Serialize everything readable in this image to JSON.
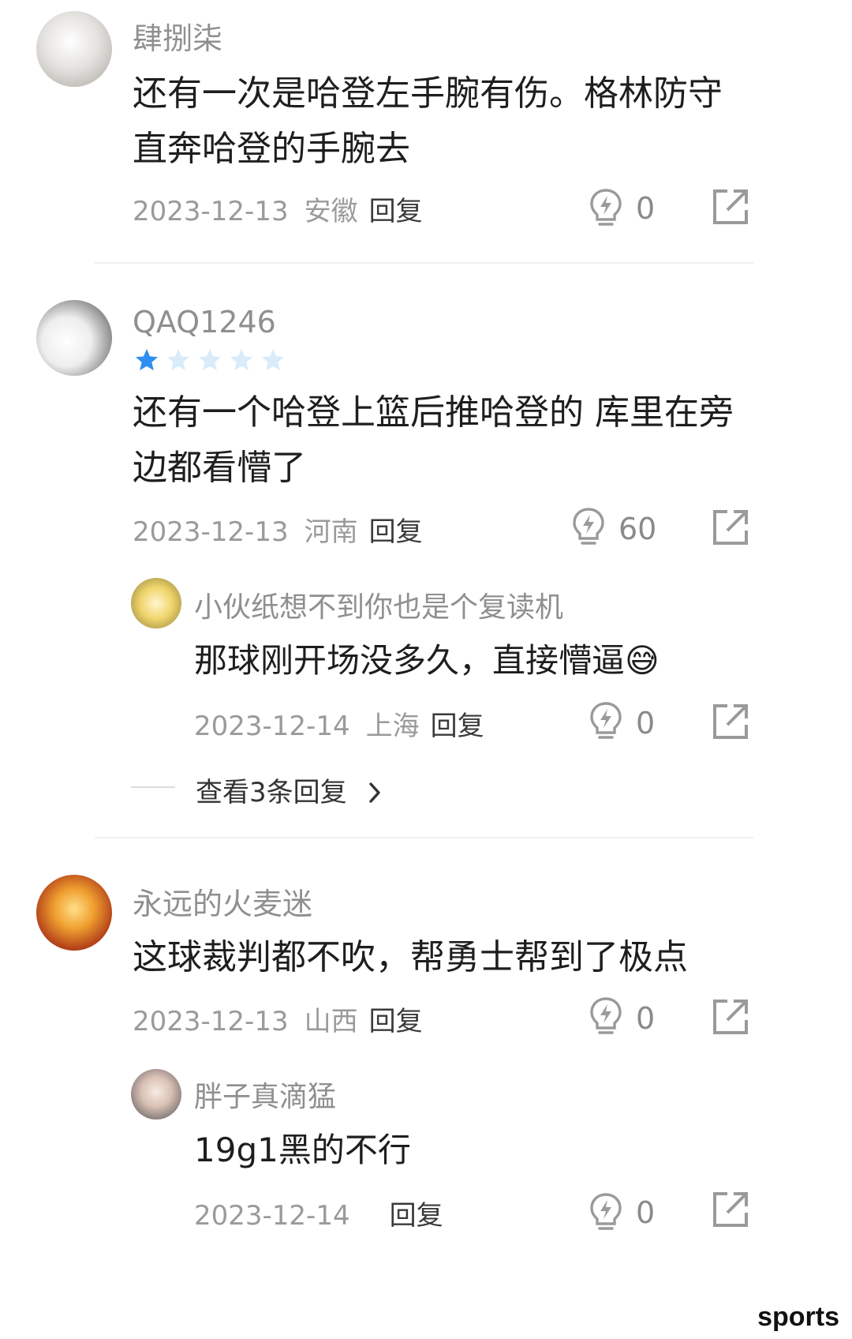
{
  "comments": [
    {
      "username": "肆捌柒",
      "content_lines": [
        "还有一次是哈登左手腕有伤。格林防守",
        "直奔哈登的手腕去"
      ],
      "date": "2023-12-13",
      "location": "安徽",
      "reply_label": "回复",
      "likes": "0"
    },
    {
      "username": "QAQ1246",
      "rating": {
        "filled": 1,
        "total": 5
      },
      "content_lines": [
        "还有一个哈登上篮后推哈登的  库里在旁",
        "边都看懵了"
      ],
      "date": "2023-12-13",
      "location": "河南",
      "reply_label": "回复",
      "likes": "60",
      "reply": {
        "username": "小伙纸想不到你也是个复读机",
        "content": "那球刚开场没多久，直接懵逼😅",
        "date": "2023-12-14",
        "location": "上海",
        "reply_label": "回复",
        "likes": "0"
      },
      "view_replies": "查看3条回复"
    },
    {
      "username": "永远的火麦迷",
      "content_lines": [
        "这球裁判都不吹，帮勇士帮到了极点"
      ],
      "date": "2023-12-13",
      "location": "山西",
      "reply_label": "回复",
      "likes": "0",
      "reply": {
        "username": "胖子真滴猛",
        "content": "19g1黑的不行",
        "date": "2023-12-14",
        "location": "",
        "reply_label": "回复",
        "likes": "0"
      }
    }
  ],
  "watermark": "sports",
  "colors": {
    "star_filled": "#2e8ff0",
    "star_empty": "#d8ecfb"
  },
  "icons": {
    "like": "lightbulb-lightning-icon",
    "share": "share-external-icon",
    "view_more": "chevron-right-icon"
  }
}
